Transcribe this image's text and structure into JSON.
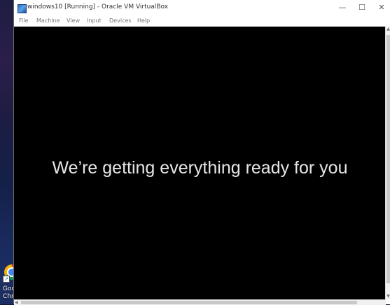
{
  "window": {
    "title": "windows10 [Running] - Oracle VM VirtualBox",
    "controls": {
      "minimize": "—",
      "maximize": "☐",
      "close": "✕"
    }
  },
  "menu": [
    "File",
    "Machine",
    "View",
    "Input",
    "Devices",
    "Help"
  ],
  "guest_screen": {
    "message": "We’re getting everything ready for you"
  },
  "desktop": {
    "icon_label": "Goo\nChr"
  }
}
